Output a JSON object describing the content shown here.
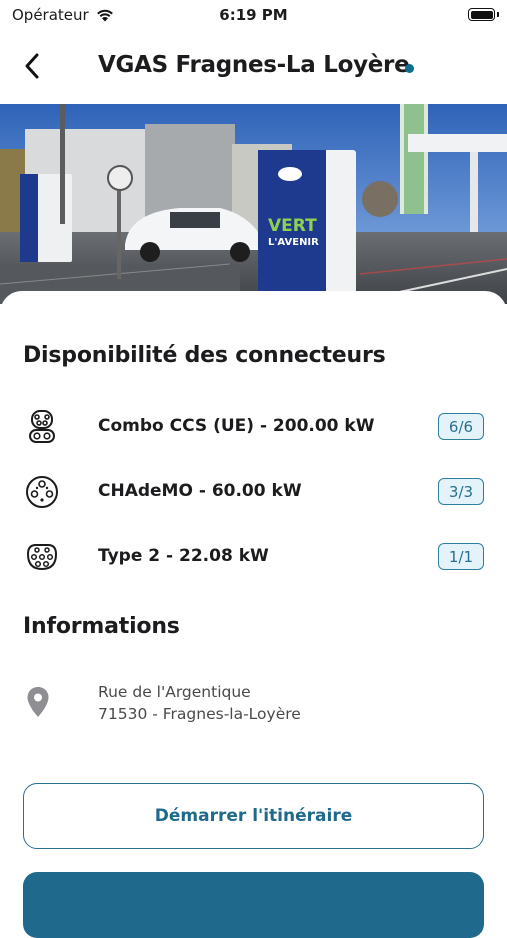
{
  "status_bar": {
    "carrier": "Opérateur",
    "time": "6:19 PM"
  },
  "nav": {
    "title": "VGAS Fragnes-La Loyère",
    "back_icon": "chevron-left-icon",
    "status_color": "#0f6d90"
  },
  "hero": {
    "charger_text_line1": "VERT",
    "charger_text_line2": "L'AVENIR"
  },
  "connectors": {
    "title": "Disponibilité des connecteurs",
    "items": [
      {
        "icon": "ccs-combo-connector-icon",
        "label": "Combo CCS (UE) - 200.00 kW",
        "availability": "6/6"
      },
      {
        "icon": "chademo-connector-icon",
        "label": "CHAdeMO - 60.00 kW",
        "availability": "3/3"
      },
      {
        "icon": "type2-connector-icon",
        "label": "Type 2 - 22.08 kW",
        "availability": "1/1"
      }
    ]
  },
  "info": {
    "title": "Informations",
    "address_icon": "location-pin-icon",
    "address_line1": "Rue de l'Argentique",
    "address_line2": "71530 - Fragnes-la-Loyère"
  },
  "actions": {
    "route_label": "Démarrer l'itinéraire"
  },
  "colors": {
    "accent": "#1f6a8c",
    "badge_bg": "#e3f3f9"
  }
}
